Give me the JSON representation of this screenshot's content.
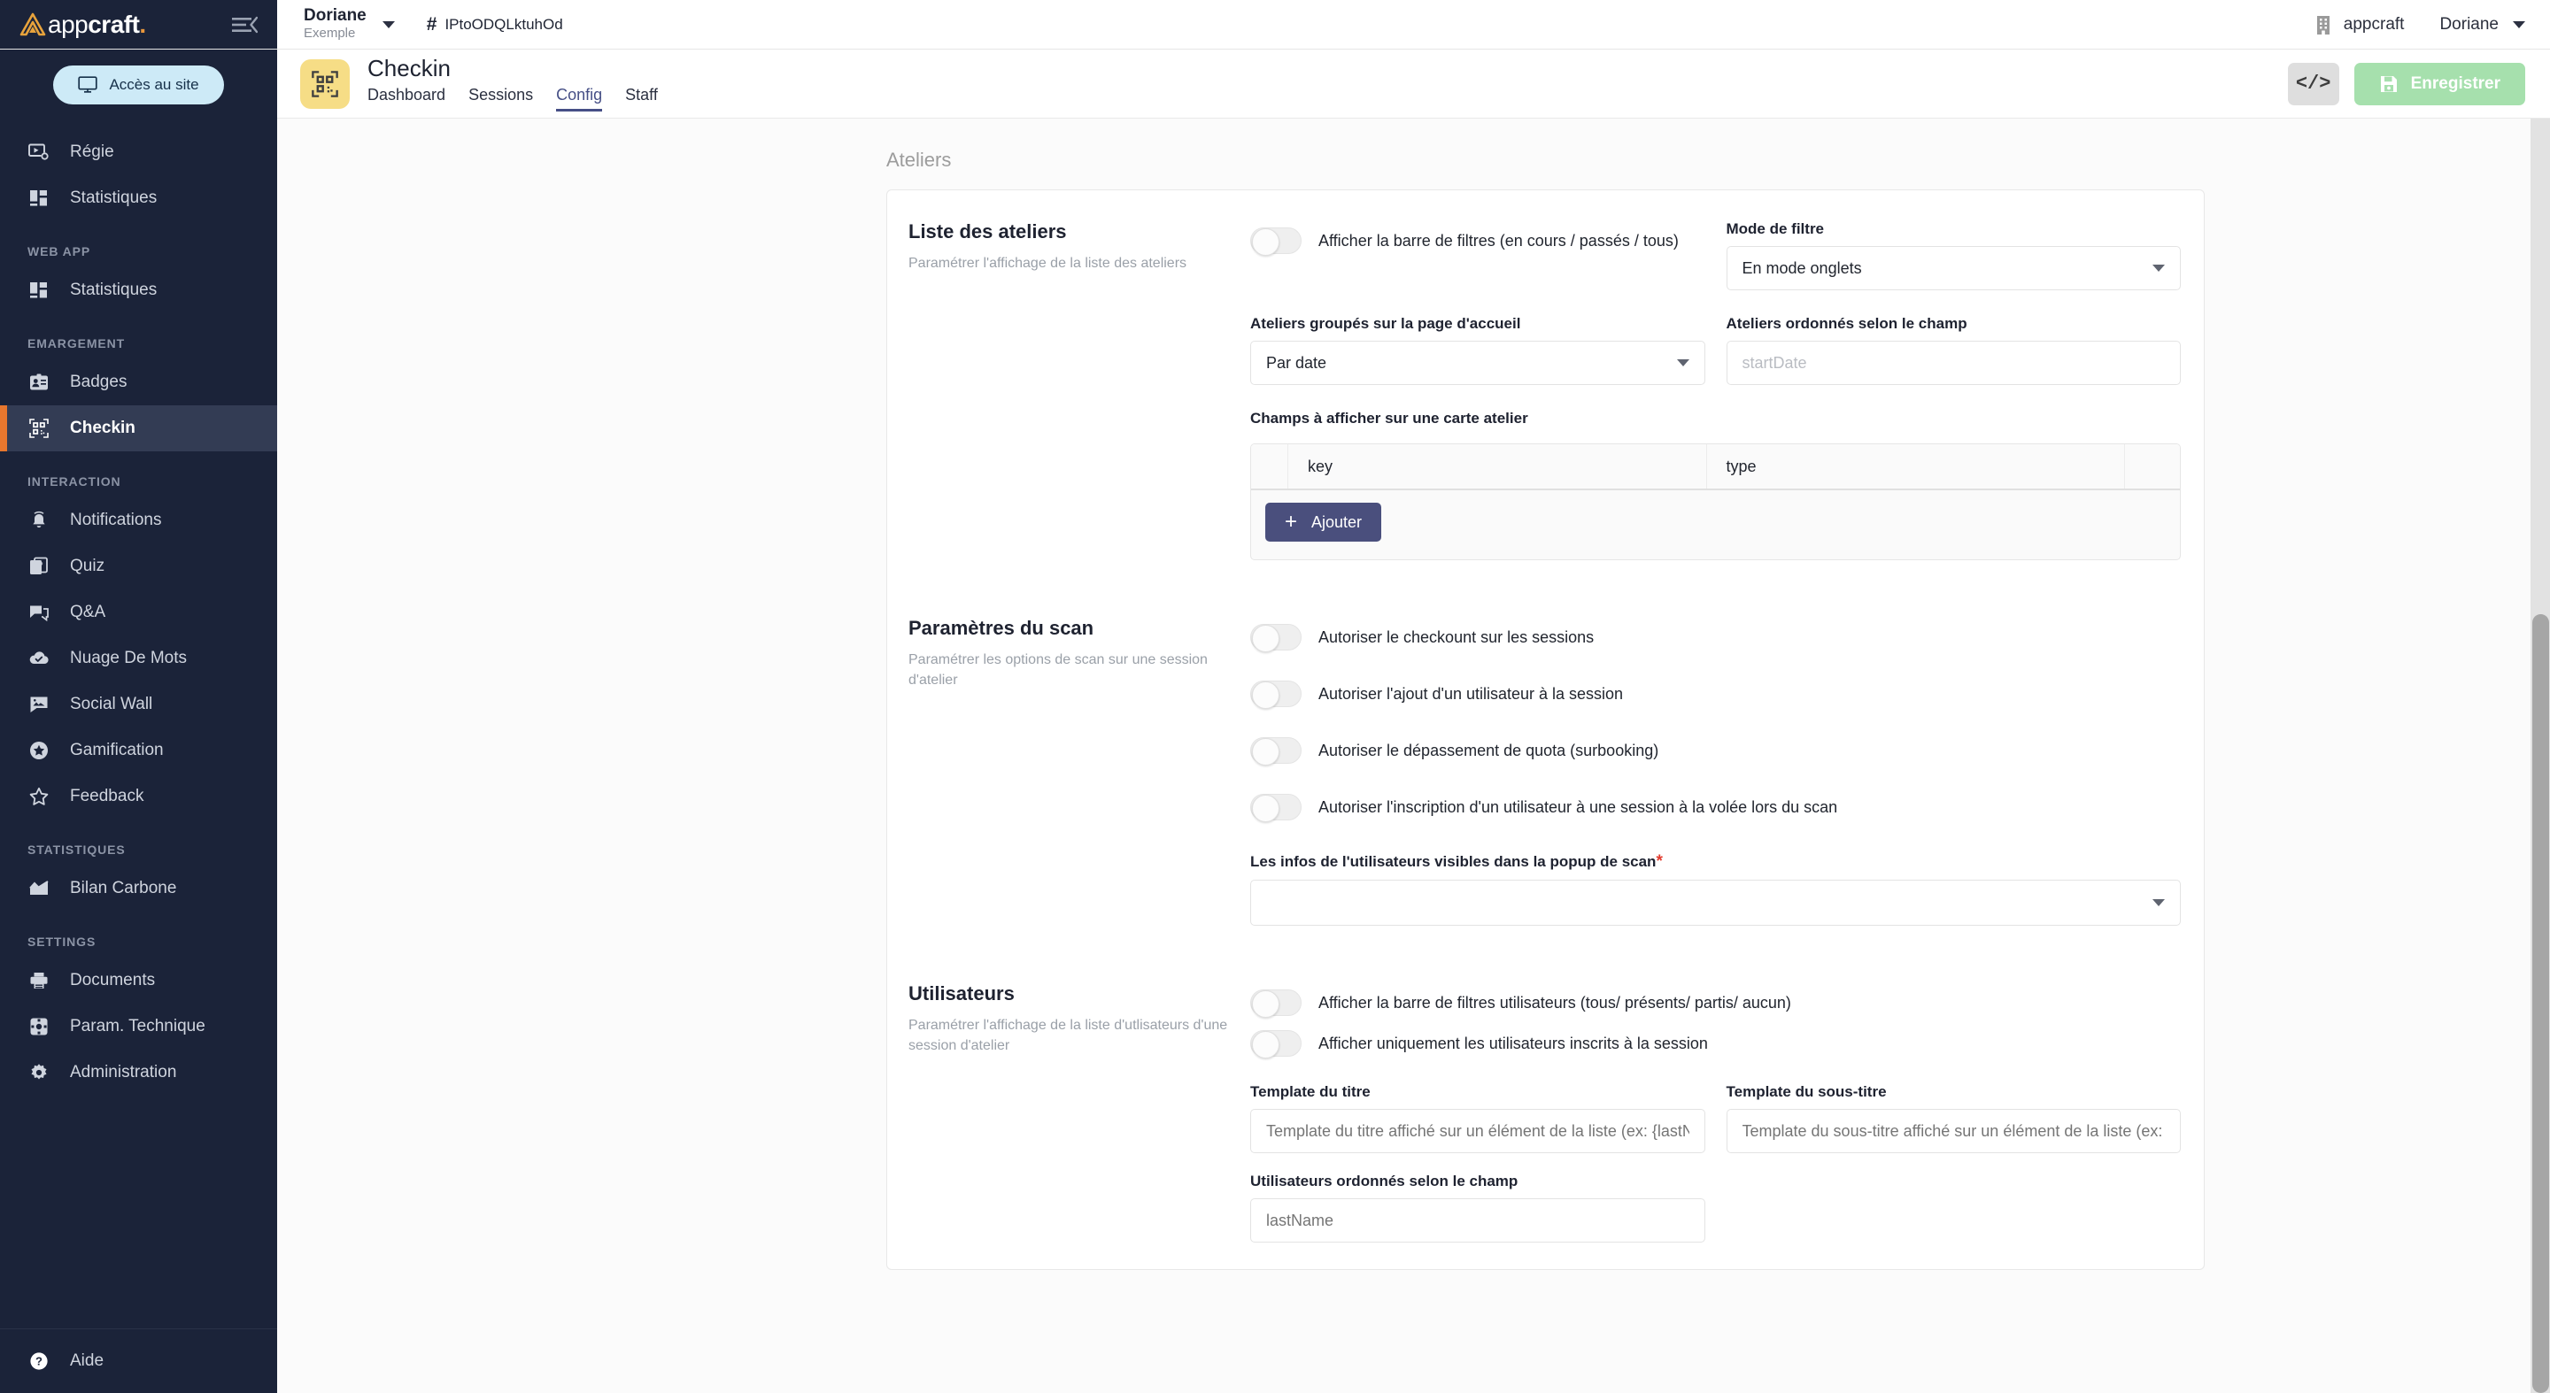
{
  "brand": {
    "name_light": "app",
    "name_bold": "craft",
    "dot": ".",
    "menu_icon": "collapse-menu-icon"
  },
  "sidebar": {
    "access_button": "Accès au site",
    "items_top": [
      {
        "label": "Régie",
        "icon": "screen-settings-icon"
      },
      {
        "label": "Statistiques",
        "icon": "dashboard-icon"
      }
    ],
    "groups": [
      {
        "title": "WEB APP",
        "items": [
          {
            "label": "Statistiques",
            "icon": "dashboard-icon"
          }
        ]
      },
      {
        "title": "EMARGEMENT",
        "items": [
          {
            "label": "Badges",
            "icon": "badge-icon"
          },
          {
            "label": "Checkin",
            "icon": "qr-code-icon",
            "active": true
          }
        ]
      },
      {
        "title": "INTERACTION",
        "items": [
          {
            "label": "Notifications",
            "icon": "bell-icon"
          },
          {
            "label": "Quiz",
            "icon": "quiz-icon"
          },
          {
            "label": "Q&A",
            "icon": "chat-icon"
          },
          {
            "label": "Nuage De Mots",
            "icon": "cloud-check-icon"
          },
          {
            "label": "Social Wall",
            "icon": "photo-message-icon"
          },
          {
            "label": "Gamification",
            "icon": "star-circle-icon"
          },
          {
            "label": "Feedback",
            "icon": "star-outline-icon"
          }
        ]
      },
      {
        "title": "STATISTIQUES",
        "items": [
          {
            "label": "Bilan Carbone",
            "icon": "chart-area-icon"
          }
        ]
      },
      {
        "title": "SETTINGS",
        "items": [
          {
            "label": "Documents",
            "icon": "printer-icon"
          },
          {
            "label": "Param. Technique",
            "icon": "settings-square-icon"
          },
          {
            "label": "Administration",
            "icon": "gear-icon"
          }
        ]
      }
    ],
    "footer": {
      "label": "Aide",
      "icon": "help-circle-icon"
    }
  },
  "topbar": {
    "workspace_name": "Doriane",
    "workspace_sub": "Exemple",
    "event_code": "IPtoODQLktuhOd",
    "org": "appcraft",
    "user": "Doriane"
  },
  "page": {
    "app_icon": "qr-code-icon",
    "title": "Checkin",
    "tabs": [
      {
        "label": "Dashboard",
        "active": false
      },
      {
        "label": "Sessions",
        "active": false
      },
      {
        "label": "Config",
        "active": true
      },
      {
        "label": "Staff",
        "active": false
      }
    ],
    "code_button": "</>",
    "save_button": "Enregistrer",
    "section_label": "Ateliers"
  },
  "blocks": {
    "liste_ateliers": {
      "title": "Liste des ateliers",
      "desc": "Paramétrer l'affichage de la liste des ateliers",
      "toggle_filters": "Afficher la barre de filtres (en cours / passés / tous)",
      "mode_filtre_label": "Mode de filtre",
      "mode_filtre_value": "En mode onglets",
      "groupes_label": "Ateliers groupés sur la page d'accueil",
      "groupes_value": "Par date",
      "ordonnes_label": "Ateliers ordonnés selon le champ",
      "ordonnes_placeholder": "startDate",
      "champs_label": "Champs à afficher sur une carte atelier",
      "table_headers": [
        "key",
        "type"
      ],
      "table_rows": [],
      "add_button": "Ajouter"
    },
    "parametres_scan": {
      "title": "Paramètres du scan",
      "desc": "Paramétrer les options de scan sur une session d'atelier",
      "toggles": [
        "Autoriser le checkount sur les sessions",
        "Autoriser l'ajout d'un utilisateur à la session",
        "Autoriser le dépassement de quota (surbooking)",
        "Autoriser l'inscription d'un utilisateur à une session à la volée lors du scan"
      ],
      "infos_label": "Les infos de l'utilisateurs visibles dans la popup de scan",
      "infos_required": "*",
      "infos_value": ""
    },
    "utilisateurs": {
      "title": "Utilisateurs",
      "desc": "Paramétrer l'affichage de la liste d'utlisateurs d'une session d'atelier",
      "toggles": [
        "Afficher la barre de filtres utilisateurs (tous/ présents/ partis/ aucun)",
        "Afficher uniquement les utilisateurs inscrits à la session"
      ],
      "template_titre_label": "Template du titre",
      "template_titre_placeholder": "Template du titre affiché sur un élément de la liste (ex: {lastName} {firstName})",
      "template_soustitre_label": "Template du sous-titre",
      "template_soustitre_placeholder": "Template du sous-titre affiché sur un élément de la liste (ex: {company})",
      "ordonnes_label": "Utilisateurs ordonnés selon le champ",
      "ordonnes_placeholder": "lastName"
    }
  },
  "colors": {
    "sidebar_bg": "#1b2339",
    "accent_orange": "#e8772e",
    "active_nav_bg": "#333c54",
    "access_btn_bg": "#cdeaf7",
    "app_badge_bg": "#f6dd86",
    "save_btn_bg": "#a6e0ad",
    "add_btn_bg": "#4a4f7d",
    "tab_active": "#464f86",
    "required_red": "#e23b2e"
  }
}
